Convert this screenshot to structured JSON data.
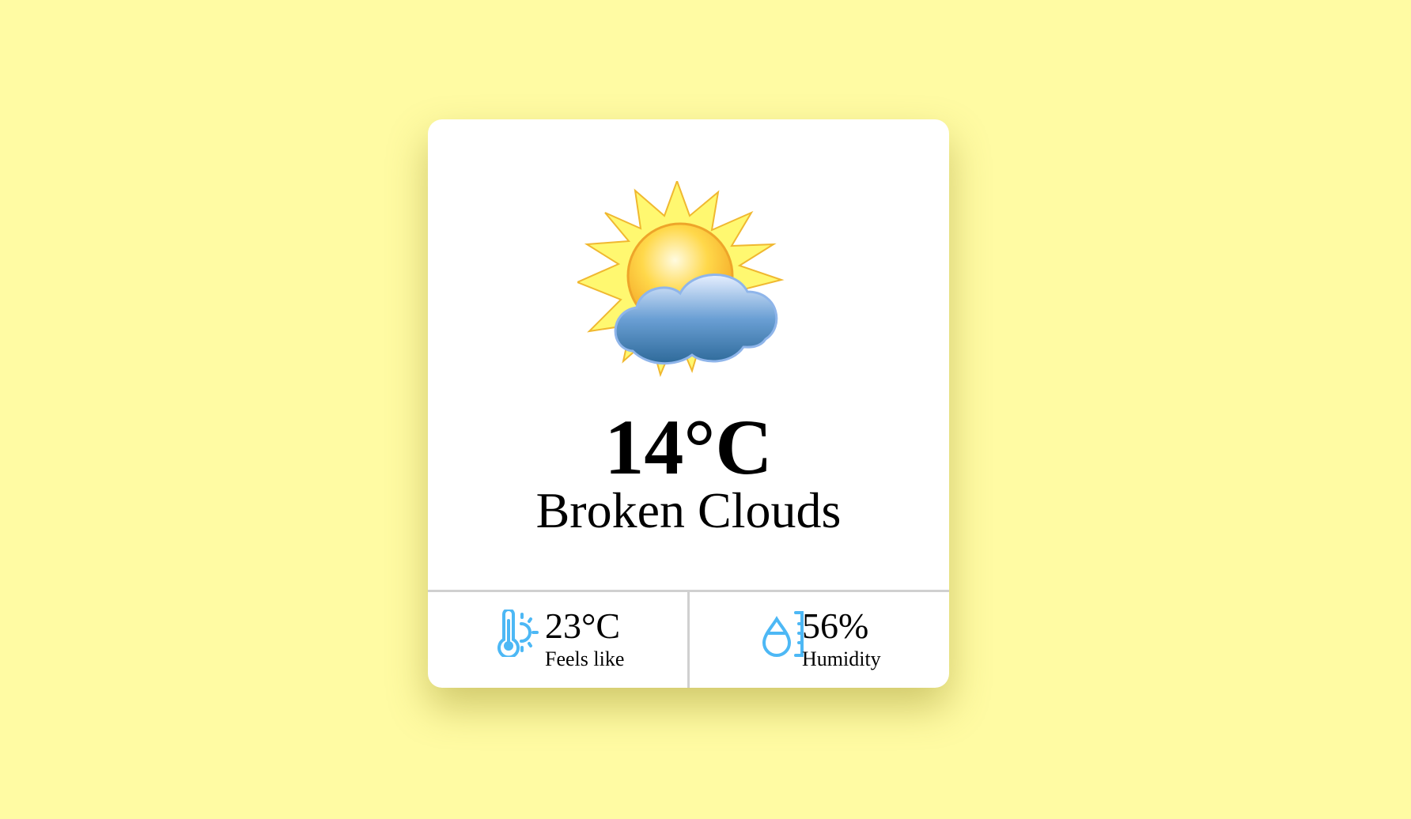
{
  "weather": {
    "icon": "sun-behind-cloud-icon",
    "temperature": "14°C",
    "description": "Broken Clouds"
  },
  "stats": [
    {
      "icon": "thermometer-sun-icon",
      "value": "23°C",
      "label": "Feels like"
    },
    {
      "icon": "humidity-drop-icon",
      "value": "56%",
      "label": "Humidity"
    }
  ],
  "colors": {
    "background": "#fffba3",
    "accent": "#4db8f5"
  }
}
